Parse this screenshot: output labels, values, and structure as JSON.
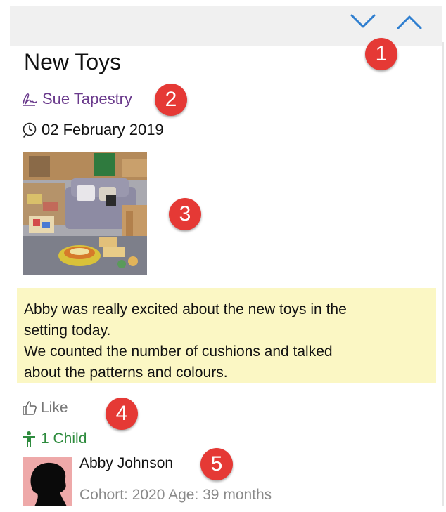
{
  "header": {
    "nav_down_icon": "chevron-down-icon",
    "nav_up_icon": "chevron-up-icon"
  },
  "observation": {
    "title": "New Toys",
    "author": "Sue Tapestry",
    "date": "02 February 2019",
    "note_lines": [
      "Abby was really excited about the new toys in the",
      "setting today.",
      "We counted the number of cushions and talked",
      "about the patterns and colours."
    ],
    "like_label": "Like",
    "children_count_label": "1 Child"
  },
  "child": {
    "name": "Abby Johnson",
    "meta": "Cohort: 2020 Age: 39 months"
  },
  "callouts": [
    "1",
    "2",
    "3",
    "4",
    "5"
  ],
  "colors": {
    "author": "#6a3a8c",
    "children": "#2e8b3e",
    "nav": "#2f7fd0",
    "note_bg": "#fbf7c4",
    "callout": "#e53935"
  }
}
